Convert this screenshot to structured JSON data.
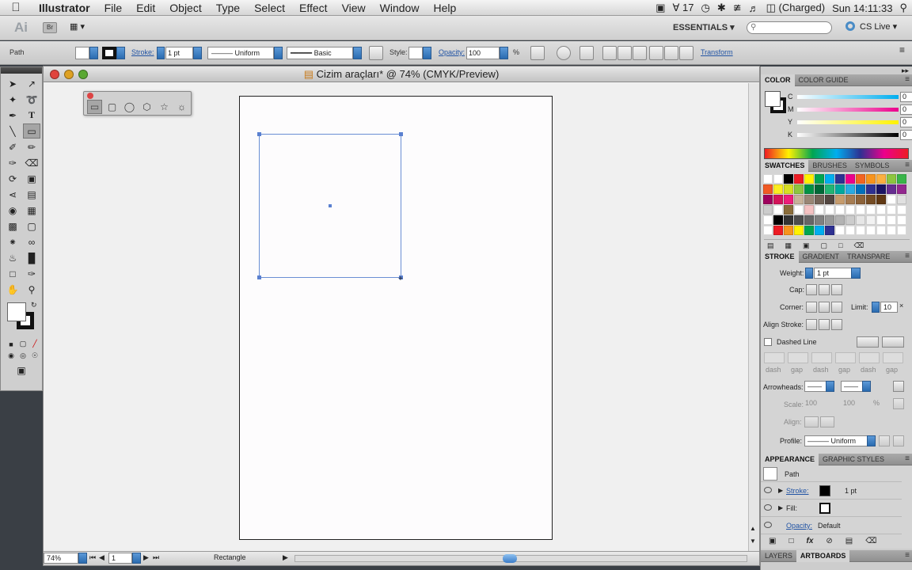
{
  "menubar": {
    "app_name": "Illustrator",
    "items": [
      "File",
      "Edit",
      "Object",
      "Type",
      "Select",
      "Effect",
      "View",
      "Window",
      "Help"
    ],
    "adobe_count": "17",
    "battery": "(Charged)",
    "clock": "Sun 14:11:33"
  },
  "appbar": {
    "logo": "Ai",
    "bridge": "Br",
    "workspace": "ESSENTIALS",
    "cs_live": "CS Live"
  },
  "controlbar": {
    "selection_type": "Path",
    "stroke_label": "Stroke:",
    "stroke_weight": "1 pt",
    "profile": "Uniform",
    "brush": "Basic",
    "style_label": "Style:",
    "opacity_label": "Opacity:",
    "opacity_value": "100",
    "opacity_unit": "%",
    "transform": "Transform"
  },
  "document": {
    "title": "Cizim araçları* @ 74% (CMYK/Preview)",
    "zoom": "74%",
    "artboard_number": "1",
    "status_tool": "Rectangle"
  },
  "color_panel": {
    "tabs": [
      "COLOR",
      "COLOR GUIDE"
    ],
    "channels": [
      {
        "label": "C",
        "value": "0",
        "unit": "%"
      },
      {
        "label": "M",
        "value": "0",
        "unit": "%"
      },
      {
        "label": "Y",
        "value": "0",
        "unit": "%"
      },
      {
        "label": "K",
        "value": "0",
        "unit": "%"
      }
    ]
  },
  "swatches_panel": {
    "tabs": [
      "SWATCHES",
      "BRUSHES",
      "SYMBOLS"
    ],
    "colors": [
      "#ffffff",
      "#ffffff",
      "#000000",
      "#ed1c24",
      "#fff200",
      "#00a651",
      "#00aeef",
      "#2e3192",
      "#ec008c",
      "#f26522",
      "#f7941d",
      "#fbb040",
      "#8dc63f",
      "#39b54a",
      "#f15a24",
      "#fbed21",
      "#d7df23",
      "#8cc63f",
      "#009245",
      "#006837",
      "#22b573",
      "#00a99d",
      "#29abe2",
      "#0071bc",
      "#2e3192",
      "#1b1464",
      "#662d91",
      "#93278f",
      "#9e005d",
      "#d4145a",
      "#ed1e79",
      "#c7b299",
      "#998675",
      "#736357",
      "#534741",
      "#c69c6d",
      "#a67c52",
      "#8c6239",
      "#754c24",
      "#603813",
      "#ffffff",
      "#e0e0e0",
      "#cccccc",
      "#ffffff",
      "#8a6d3b",
      "#ffffff",
      "#f4c2c2",
      "#ffffff",
      "#ffffff",
      "#ffffff",
      "#ffffff",
      "#ffffff",
      "#ffffff",
      "#ffffff",
      "#ffffff",
      "#ffffff",
      "#ffffff",
      "#000000",
      "#333333",
      "#4d4d4d",
      "#666666",
      "#808080",
      "#999999",
      "#b3b3b3",
      "#cccccc",
      "#e6e6e6",
      "#f2f2f2",
      "#ffffff",
      "#ffffff",
      "#ffffff",
      "#ffffff",
      "#ed1c24",
      "#f7941d",
      "#fff200",
      "#00a651",
      "#00aeef",
      "#2e3192",
      "#ffffff",
      "#ffffff",
      "#ffffff",
      "#ffffff",
      "#ffffff",
      "#ffffff",
      "#ffffff"
    ]
  },
  "stroke_panel": {
    "tabs": [
      "STROKE",
      "GRADIENT",
      "TRANSPARE"
    ],
    "weight_label": "Weight:",
    "weight_value": "1 pt",
    "cap_label": "Cap:",
    "corner_label": "Corner:",
    "limit_label": "Limit:",
    "limit_value": "10",
    "align_label": "Align Stroke:",
    "dashed_label": "Dashed Line",
    "dash_labels": [
      "dash",
      "gap",
      "dash",
      "gap",
      "dash",
      "gap"
    ],
    "arrowheads_label": "Arrowheads:",
    "scale_label": "Scale:",
    "scale_values": [
      "100",
      "100"
    ],
    "scale_unit": "%",
    "align_arrow_label": "Align:",
    "profile_label": "Profile:",
    "profile_value": "Uniform"
  },
  "appearance_panel": {
    "tabs": [
      "APPEARANCE",
      "GRAPHIC STYLES"
    ],
    "object": "Path",
    "stroke_label": "Stroke:",
    "stroke_value": "1 pt",
    "fill_label": "Fill:",
    "opacity_label": "Opacity:",
    "opacity_value": "Default"
  },
  "bottom_tabs": [
    "LAYERS",
    "ARTBOARDS"
  ]
}
